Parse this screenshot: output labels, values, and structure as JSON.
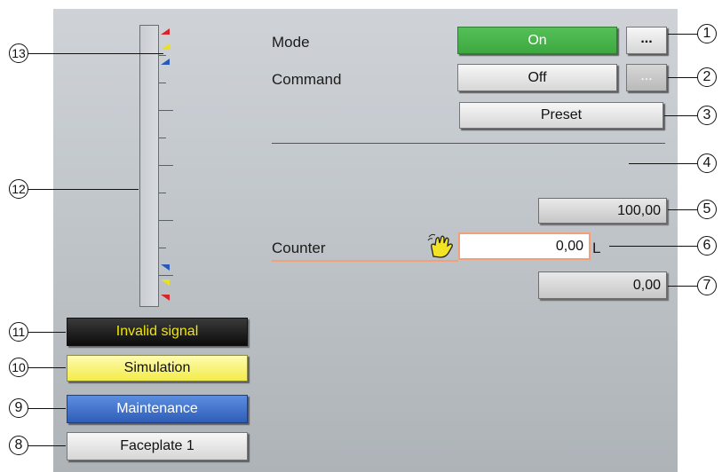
{
  "mode": {
    "label": "Mode",
    "value": "On",
    "more_label": "..."
  },
  "command": {
    "label": "Command",
    "value": "Off",
    "more_label": "..."
  },
  "preset": {
    "label": "Preset"
  },
  "limit_value": "100,00",
  "counter": {
    "label": "Counter",
    "value": "0,00",
    "unit": "L"
  },
  "lower_value": "0,00",
  "status_buttons": {
    "invalid_signal": "Invalid signal",
    "simulation": "Simulation",
    "maintenance": "Maintenance",
    "faceplate": "Faceplate 1"
  },
  "callouts": [
    "1",
    "2",
    "3",
    "4",
    "5",
    "6",
    "7",
    "8",
    "9",
    "10",
    "11",
    "12",
    "13"
  ],
  "colors": {
    "on_green": "#4cb54e",
    "invalid_text": "#f2e600",
    "simulation_yellow": "#f6f16a",
    "maintenance_blue": "#3d6bc4",
    "counter_border": "#f0a07a",
    "marker_red": "#d7262b",
    "marker_yellow": "#e8e020",
    "marker_blue": "#2a58b8"
  },
  "icons": {
    "counter": "hand-icon",
    "more": "ellipsis-icon"
  }
}
